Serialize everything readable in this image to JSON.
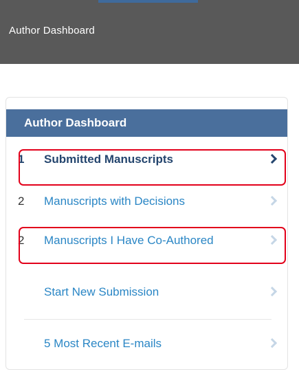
{
  "header": {
    "title": "Author Dashboard"
  },
  "panel": {
    "title": "Author Dashboard",
    "items": [
      {
        "count": "1",
        "label": "Submitted Manuscripts",
        "active": true,
        "highlighted": true
      },
      {
        "count": "2",
        "label": "Manuscripts with Decisions",
        "active": false,
        "highlighted": false
      },
      {
        "count": "2",
        "label": "Manuscripts I Have Co-Authored",
        "active": false,
        "highlighted": true
      },
      {
        "count": "",
        "label": "Start New Submission",
        "active": false,
        "highlighted": false
      },
      {
        "count": "",
        "label": "5 Most Recent E-mails",
        "active": false,
        "highlighted": false
      }
    ]
  },
  "colors": {
    "header_bg": "#595959",
    "panel_header_bg": "#4a6f9c",
    "link": "#2a86c5",
    "active_link": "#24456e",
    "highlight": "#e2001a"
  },
  "icons": {
    "chevron": "chevron-right-icon"
  }
}
